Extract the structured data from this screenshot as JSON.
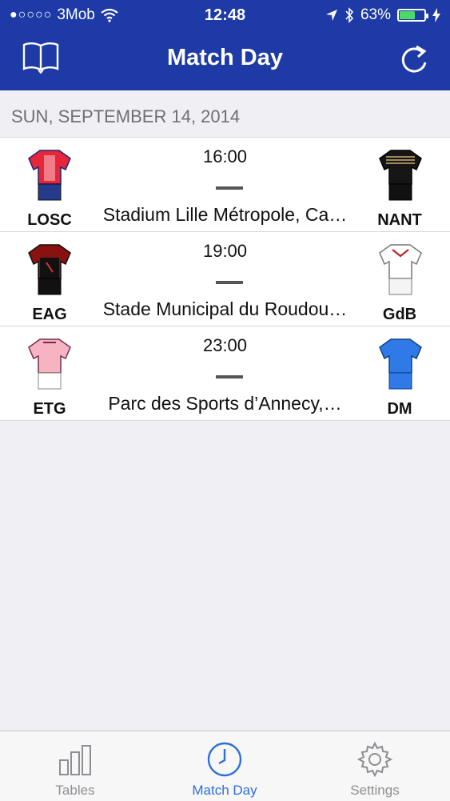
{
  "status_bar": {
    "carrier": "3Mob",
    "signal": "●○○○○",
    "time": "12:48",
    "battery": "63%",
    "battery_level": 0.63,
    "battery_color": "#4cd964"
  },
  "nav": {
    "title": "Match Day",
    "left_icon": "book-icon",
    "right_icon": "refresh-icon",
    "bar_color": "#1d3aa6"
  },
  "date_header": "SUN, SEPTEMBER 14, 2014",
  "matches": [
    {
      "time": "16:00",
      "venue": "Stadium Lille Métropole, Ca…",
      "home": "LOSC",
      "away": "NANT"
    },
    {
      "time": "19:00",
      "venue": "Stade Municipal du Roudou…",
      "home": "EAG",
      "away": "GdB"
    },
    {
      "time": "23:00",
      "venue": "Parc des Sports d’Annecy,…",
      "home": "ETG",
      "away": "DM"
    }
  ],
  "tabs": [
    {
      "label": "Tables",
      "icon": "bar-chart-icon"
    },
    {
      "label": "Match Day",
      "icon": "clock-icon",
      "active": true
    },
    {
      "label": "Settings",
      "icon": "gear-icon"
    }
  ],
  "accent_color": "#2f6fd6"
}
